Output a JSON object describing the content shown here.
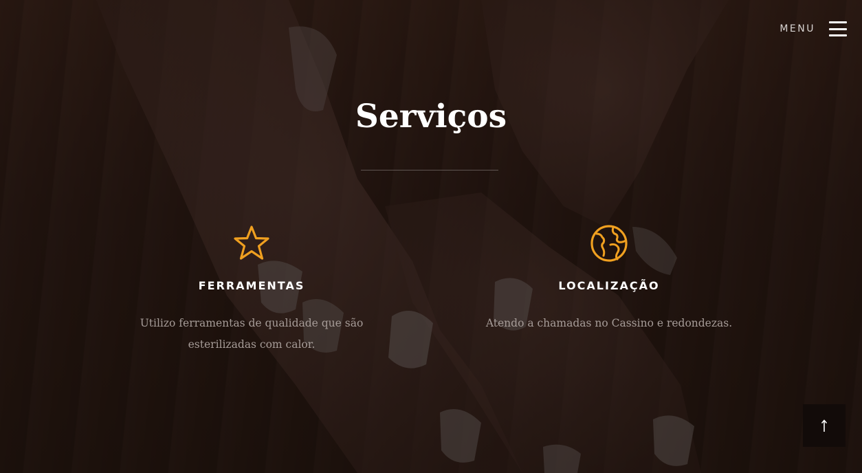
{
  "header": {
    "menu_label": "MENU"
  },
  "section": {
    "title": "Serviços"
  },
  "services": [
    {
      "icon": "star-icon",
      "title": "FERRAMENTAS",
      "description": "Utilizo ferramentas de qualidade que são esterilizadas com calor."
    },
    {
      "icon": "globe-icon",
      "title": "LOCALIZAÇÃO",
      "description": "Atendo a chamadas no Cassino e redondezas."
    }
  ],
  "colors": {
    "accent": "#f0a020",
    "background": "#2c1a13",
    "text_muted": "#a69c98"
  }
}
